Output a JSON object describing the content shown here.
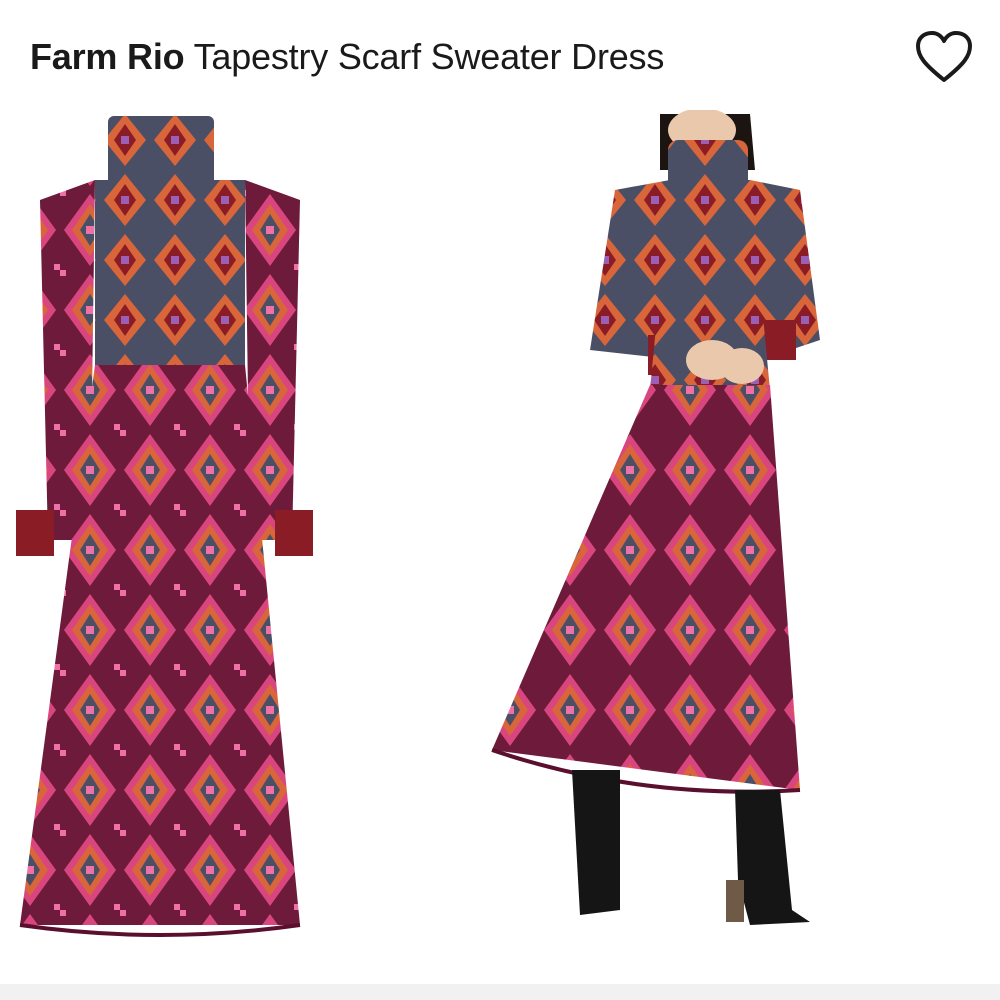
{
  "product": {
    "brand": "Farm Rio",
    "name": "Tapestry Scarf Sweater Dress"
  },
  "favorite": {
    "icon": "heart-outline-icon",
    "color": "#1a1a1a"
  },
  "images": [
    {
      "view": "flat product view"
    },
    {
      "view": "model wearing dress with black boots"
    }
  ],
  "colors": {
    "burgundy": "#6e1a3a",
    "magenta": "#d9467f",
    "pink": "#ef6fa7",
    "orange": "#d8663a",
    "slate": "#4b4f66",
    "deep_red": "#8a1c26"
  }
}
